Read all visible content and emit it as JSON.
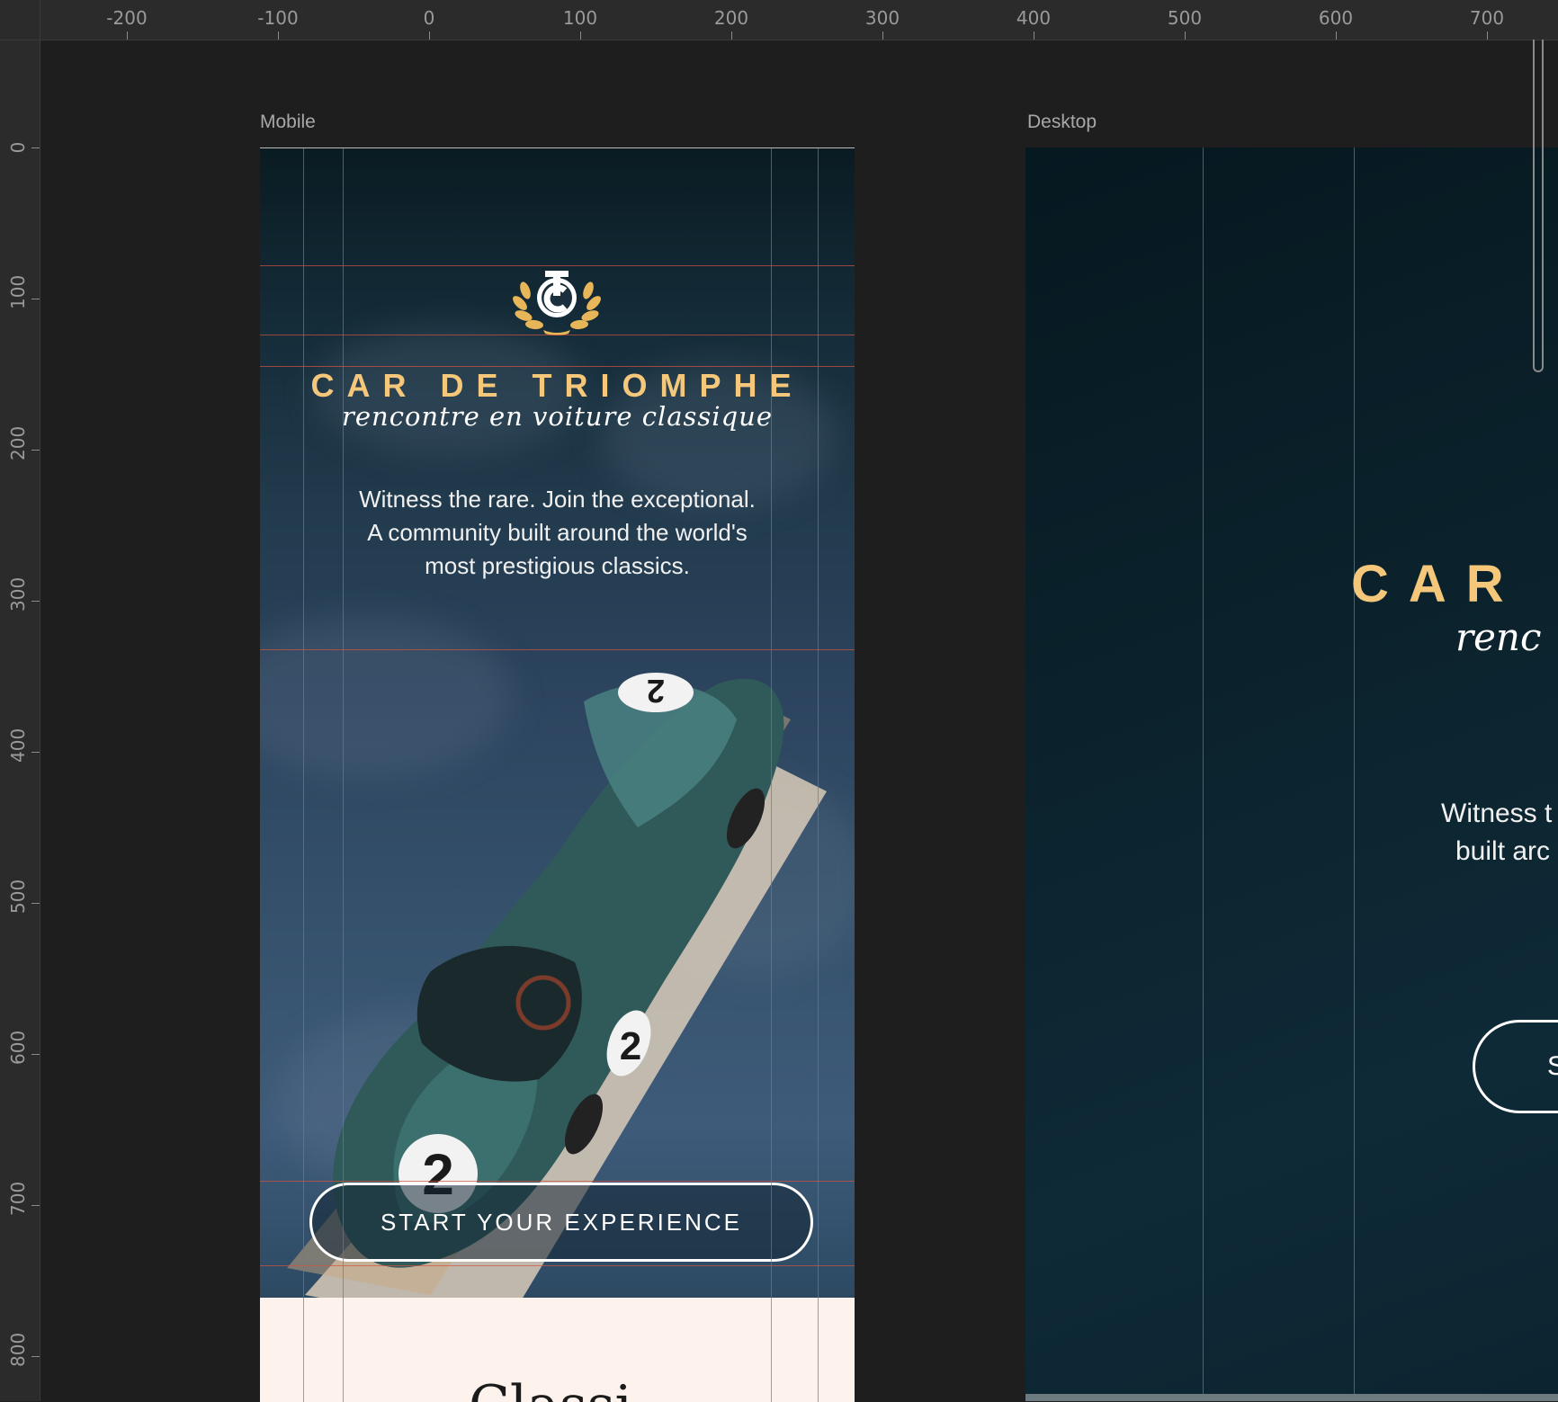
{
  "ruler": {
    "h_labels": [
      "-200",
      "-100",
      "0",
      "100",
      "200",
      "300",
      "400",
      "500",
      "600",
      "700"
    ],
    "v_labels": [
      "0",
      "100",
      "200",
      "300",
      "400",
      "500",
      "600",
      "700",
      "800"
    ]
  },
  "frames": {
    "mobile_label": "Mobile",
    "desktop_label": "Desktop"
  },
  "mobile": {
    "logo_monogram": "TC",
    "brand_title": "CAR DE TRIOMPHE",
    "tagline": "rencontre en voiture classique",
    "hero_copy": "Witness the rare. Join the exceptional. A community built around the world's most prestigious classics.",
    "car_number": "2",
    "cta_label": "START YOUR EXPERIENCE",
    "next_heading": "Classi"
  },
  "desktop": {
    "title_visible": "CAR",
    "tagline_visible": "renc",
    "copy_line_1": "Witness t",
    "copy_line_2": "built arc",
    "cta_visible": "S"
  },
  "colors": {
    "gold": "#f4c77a",
    "guide_red": "#d65240",
    "canvas": "#1e1e1e",
    "cream": "#fdf2ec"
  }
}
